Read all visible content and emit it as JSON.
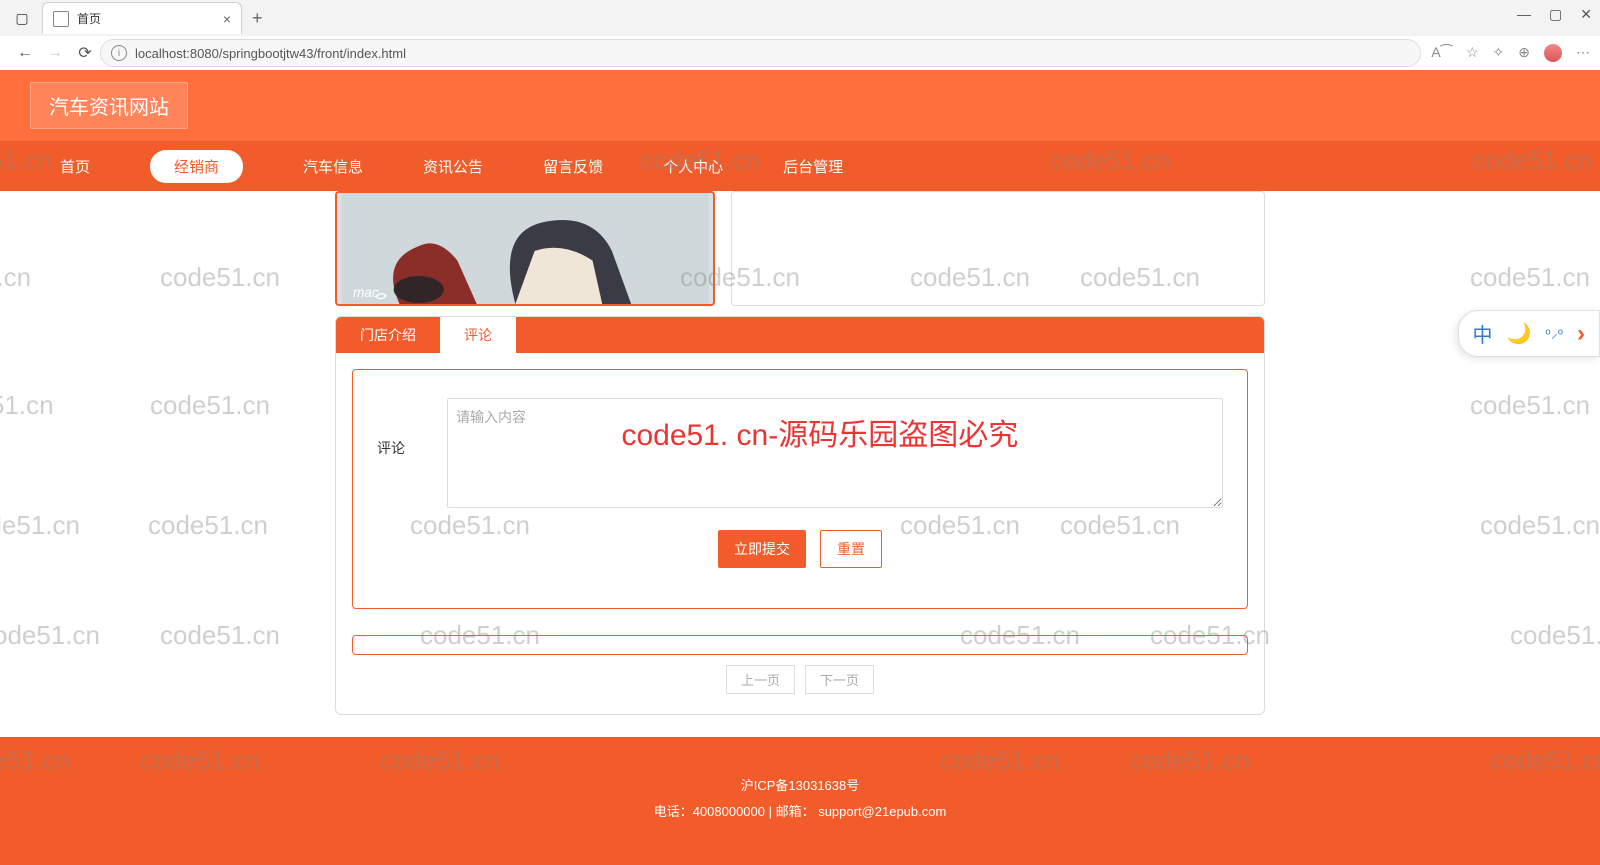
{
  "browser": {
    "tab_title": "首页",
    "url": "localhost:8080/springbootjtw43/front/index.html"
  },
  "site": {
    "title": "汽车资讯网站"
  },
  "nav": {
    "items": [
      {
        "label": "首页"
      },
      {
        "label": "经销商"
      },
      {
        "label": "汽车信息"
      },
      {
        "label": "资讯公告"
      },
      {
        "label": "留言反馈"
      },
      {
        "label": "个人中心"
      },
      {
        "label": "后台管理"
      }
    ],
    "active_index": 1
  },
  "tabs": {
    "items": [
      {
        "label": "门店介绍"
      },
      {
        "label": "评论"
      }
    ],
    "active_index": 1
  },
  "form": {
    "label": "评论",
    "placeholder": "请输入内容",
    "submit": "立即提交",
    "reset": "重置"
  },
  "pager": {
    "prev": "上一页",
    "next": "下一页"
  },
  "footer": {
    "icp": "沪ICP备13031638号",
    "contact": "电话：4008000000 | 邮箱： support@21epub.com"
  },
  "watermark": {
    "small": "code51.cn",
    "partial": "51.cn",
    "partial2": "1.cn",
    "red": "code51. cn-源码乐园盗图必究"
  },
  "floater": {
    "lang": "中",
    "moon": "moon-icon",
    "arrow": "›"
  }
}
